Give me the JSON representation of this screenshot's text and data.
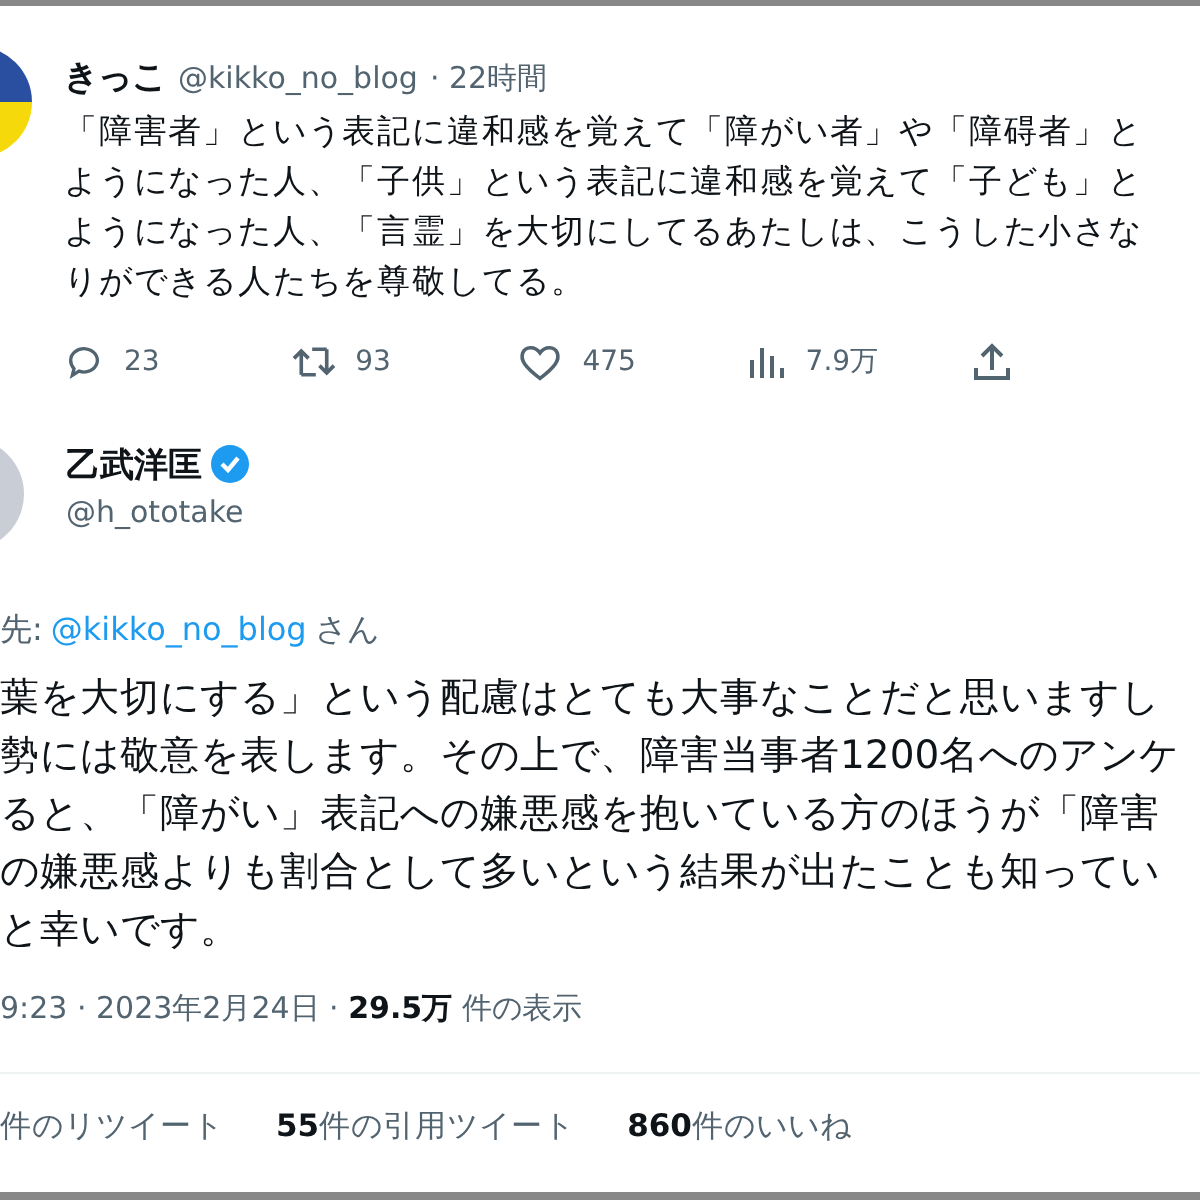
{
  "tweet": {
    "name": "きっこ",
    "handle": "@kikko_no_blog",
    "time": "· 22時間",
    "lines": [
      "「障害者」という表記に違和感を覚えて「障がい者」や「障碍者」と",
      "ようになった人、「子供」という表記に違和感を覚えて「子ども」と",
      "ようになった人、「言霊」を大切にしてるあたしは、こうした小さな",
      "りができる人たちを尊敬してる。"
    ],
    "actions": [
      {
        "kind": "reply",
        "count": "23"
      },
      {
        "kind": "retweet",
        "count": "93"
      },
      {
        "kind": "like",
        "count": "475"
      },
      {
        "kind": "views",
        "count": "7.9万"
      },
      {
        "kind": "share"
      }
    ]
  },
  "reply": {
    "name": "乙武洋匡",
    "verified": true,
    "handle": "@h_ototake",
    "reply_to_prefix": "先:",
    "reply_to_link": "@kikko_no_blog",
    "reply_to_suffix": "さん",
    "lines": [
      "葉を大切にする」という配慮はとても大事なことだと思いますし",
      "勢には敬意を表します。その上で、障害当事者1200名へのアンケ",
      "ると、「障がい」表記への嫌悪感を抱いている方のほうが「障害",
      "の嫌悪感よりも割合として多いという結果が出たことも知ってい",
      "と幸いです。"
    ],
    "meta": "9:23 · 2023年2月24日 · **29.5万** 件の表示",
    "stats": [
      {
        "label": "件のリツイート"
      },
      {
        "number": "55",
        "label": "件の引用ツイート"
      },
      {
        "number": "860",
        "label": "件のいいね"
      }
    ]
  }
}
